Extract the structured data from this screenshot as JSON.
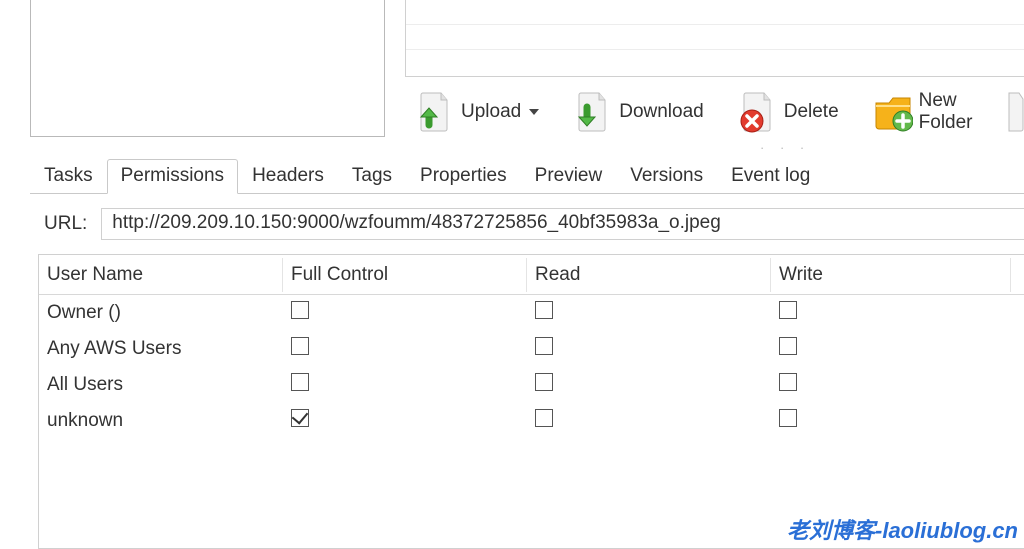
{
  "toolbar": {
    "upload": "Upload",
    "download": "Download",
    "delete": "Delete",
    "new_folder": "New Folder"
  },
  "tabs": [
    "Tasks",
    "Permissions",
    "Headers",
    "Tags",
    "Properties",
    "Preview",
    "Versions",
    "Event log"
  ],
  "active_tab_index": 1,
  "url": {
    "label": "URL:",
    "value": "http://209.209.10.150:9000/wzfoumm/48372725856_40bf35983a_o.jpeg"
  },
  "perm": {
    "headers": [
      "User Name",
      "Full Control",
      "Read",
      "Write"
    ],
    "rows": [
      {
        "name": "Owner ()",
        "full": false,
        "read": false,
        "write": false
      },
      {
        "name": "Any AWS Users",
        "full": false,
        "read": false,
        "write": false
      },
      {
        "name": "All Users",
        "full": false,
        "read": false,
        "write": false
      },
      {
        "name": "unknown",
        "full": true,
        "read": false,
        "write": false
      }
    ]
  },
  "watermark": "老刘博客-laoliublog.cn"
}
